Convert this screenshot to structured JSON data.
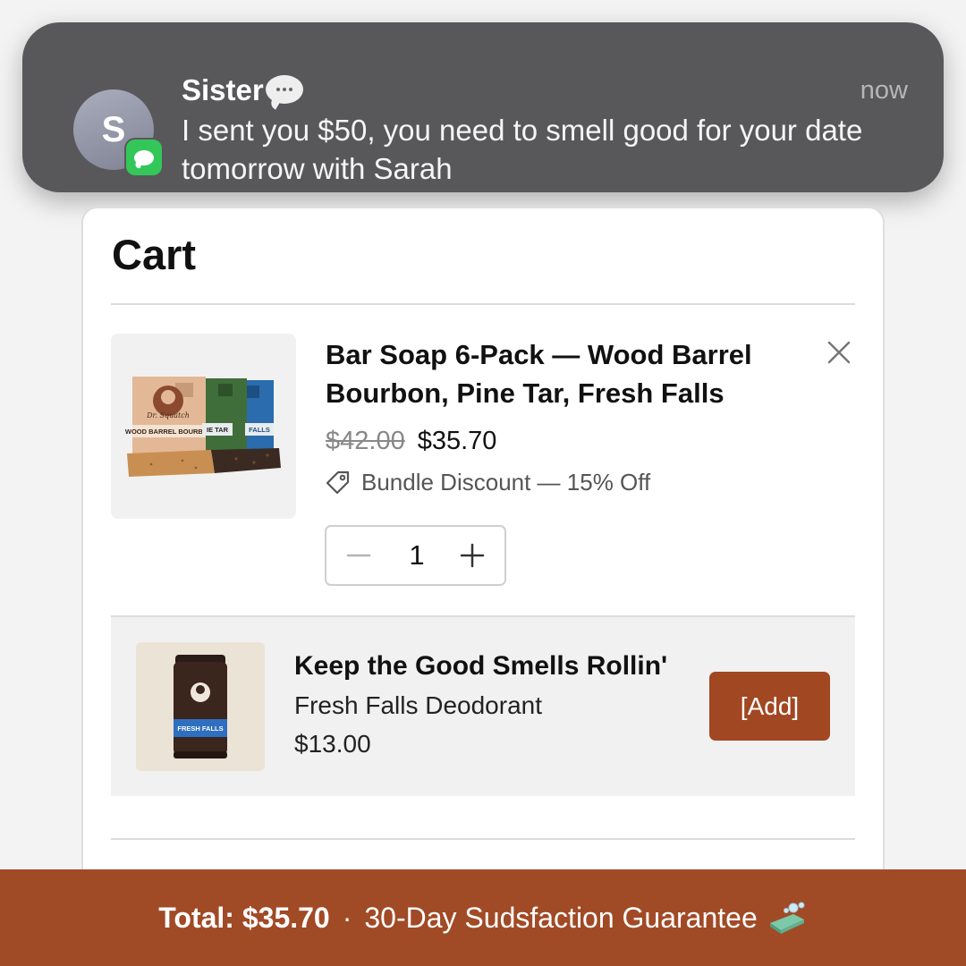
{
  "notification": {
    "avatar_initial": "S",
    "sender": "Sister",
    "time": "now",
    "message": "I sent you $50, you need to smell good for your date tomorrow with Sarah",
    "app_icon": "messages-icon"
  },
  "cart": {
    "title": "Cart",
    "item": {
      "name": "Bar Soap 6-Pack — Wood Barrel Bourbon, Pine Tar, Fresh Falls",
      "price_original": "$42.00",
      "price_current": "$35.70",
      "discount_label": "Bundle Discount — 15% Off",
      "quantity": "1",
      "soap_labels": [
        "WOOD BARREL BOURBON",
        "IE TAR",
        "FALLS"
      ],
      "brand": "Dr. Squatch"
    },
    "upsell": {
      "title": "Keep the Good Smells Rollin'",
      "product": "Fresh Falls Deodorant",
      "price": "$13.00",
      "button_label": "[Add]",
      "product_label": "FRESH FALLS"
    }
  },
  "footer": {
    "total": "Total: $35.70",
    "separator": "·",
    "guarantee": "30-Day Sudsfaction Guarantee"
  },
  "colors": {
    "accent": "#a14a26",
    "notification_bg": "#58585a",
    "messages_green": "#33c759"
  }
}
